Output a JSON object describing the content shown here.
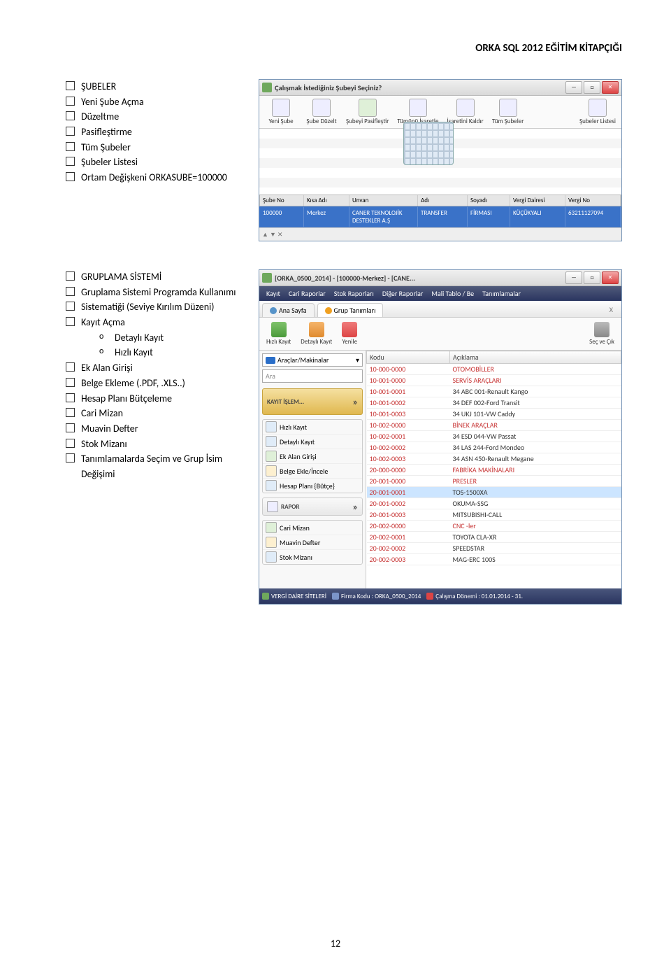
{
  "header": {
    "title": "ORKA SQL 2012 EĞİTİM KİTAPÇIĞI"
  },
  "section1": {
    "heading": "ŞUBELER",
    "items": [
      "Yeni Şube Açma",
      "Düzeltme",
      "Pasifleştirme",
      "Tüm Şubeler",
      "Şubeler Listesi",
      "Ortam Değişkeni ORKASUBE=100000"
    ]
  },
  "section2": {
    "heading": "GRUPLAMA SİSTEMİ",
    "items": [
      "Gruplama Sistemi Programda Kullanımı",
      "Sistematiği (Seviye Kırılım Düzeni)",
      "Kayıt Açma",
      "Ek Alan Girişi",
      "Belge  Ekleme (.PDF, .XLS..)",
      "Hesap Planı Bütçeleme",
      "Cari Mizan",
      "Muavin Defter",
      "Stok Mizanı",
      "Tanımlamalarda Seçim ve Grup İsim Değişimi"
    ],
    "subitems": [
      "Detaylı Kayıt",
      "Hızlı Kayıt"
    ]
  },
  "win1": {
    "title": "Çalışmak İstediğiniz Şubeyi Seçiniz?",
    "toolbar": [
      "Yeni Şube",
      "Şube Düzelt",
      "Şubeyi Pasifleştir",
      "Tümünü İşaretle",
      "İşaretini Kaldır",
      "Tüm Şubeler",
      "Şubeler Listesi"
    ],
    "columns": [
      "Şube No",
      "Kısa Adı",
      "Unvan",
      "Adı",
      "Soyadı",
      "Vergi Dairesi",
      "Vergi No"
    ],
    "row": {
      "no": "100000",
      "kisa": "Merkez",
      "unvan": "CANER TEKNOLOJİK DESTEKLER A.Ş",
      "adi": "TRANSFER",
      "soyadi": "FİRMASI",
      "vd": "KÜÇÜKYALI",
      "vno": "63211127094"
    }
  },
  "win2": {
    "title": "[ORKA_0500_2014]  -  [100000-Merkez]  -  [CANE...",
    "menu": [
      "Kayıt",
      "Cari Raporlar",
      "Stok Raporları",
      "Diğer Raporlar",
      "Mali Tablo / Be",
      "Tanımlamalar"
    ],
    "tabs": {
      "t1": "Ana Sayfa",
      "t2": "Grup Tanımları",
      "close": "X"
    },
    "subbtns": {
      "hk": "Hızlı Kayıt",
      "dk": "Detaylı Kayıt",
      "yn": "Yenile",
      "sc": "Seç ve Çık"
    },
    "combo": "Araçlar/Makinalar",
    "search": "Ara",
    "cat": "KAYIT İŞLEM...",
    "panel1": [
      "Hızlı Kayıt",
      "Detaylı Kayıt",
      "Ek Alan Girişi",
      "Belge Ekle/İncele",
      "Hesap Planı {Bütçe}"
    ],
    "rapor": "RAPOR",
    "panel2": [
      "Cari Mizan",
      "Muavin Defter",
      "Stok Mizanı"
    ],
    "cols": {
      "kodu": "Kodu",
      "acik": "Açıklama"
    },
    "rows": [
      {
        "k": "10-000-0000",
        "a": "OTOMOBİLLER",
        "red": true
      },
      {
        "k": "10-001-0000",
        "a": "SERVİS ARAÇLARI",
        "red": true
      },
      {
        "k": "10-001-0001",
        "a": "34 ABC 001-Renault Kango"
      },
      {
        "k": "10-001-0002",
        "a": "34 DEF 002-Ford Transit"
      },
      {
        "k": "10-001-0003",
        "a": "34 UKJ 101-VW Caddy"
      },
      {
        "k": "10-002-0000",
        "a": "BİNEK ARAÇLAR",
        "red": true
      },
      {
        "k": "10-002-0001",
        "a": "34 ESD 044-VW Passat"
      },
      {
        "k": "10-002-0002",
        "a": "34 LAS 244-Ford Mondeo"
      },
      {
        "k": "10-002-0003",
        "a": "34 ASN 450-Renault Megane"
      },
      {
        "k": "20-000-0000",
        "a": "FABRİKA MAKİNALARI",
        "red": true
      },
      {
        "k": "20-001-0000",
        "a": "PRESLER",
        "red": true
      },
      {
        "k": "20-001-0001",
        "a": "TOS-1500XA",
        "sel": true
      },
      {
        "k": "20-001-0002",
        "a": "OKUMA-SSG"
      },
      {
        "k": "20-001-0003",
        "a": "MITSUBISHI-CALL"
      },
      {
        "k": "20-002-0000",
        "a": "CNC -ler",
        "red": true
      },
      {
        "k": "20-002-0001",
        "a": "TOYOTA CLA-XR"
      },
      {
        "k": "20-002-0002",
        "a": "SPEEDSTAR"
      },
      {
        "k": "20-002-0003",
        "a": "MAG-ERC 100S"
      }
    ],
    "status": {
      "v": "VERGİ DAİRE SİTELERİ",
      "f": "Firma Kodu : ORKA_0500_2014",
      "c": "Çalışma Dönemi : 01.01.2014 - 31."
    }
  },
  "footer": {
    "page": "12"
  }
}
